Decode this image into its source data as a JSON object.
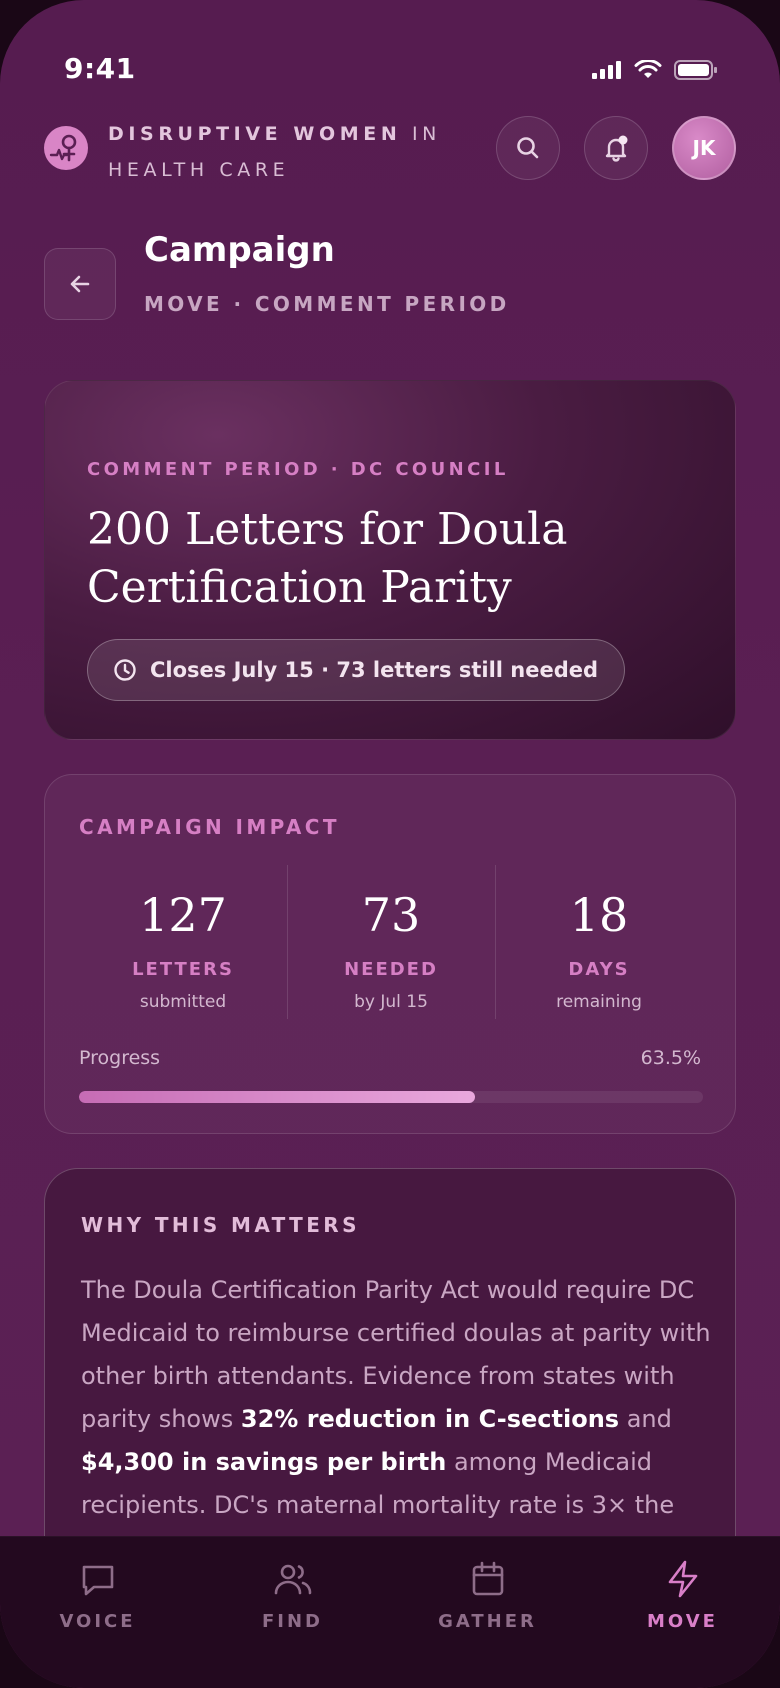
{
  "status": {
    "time": "9:41"
  },
  "header": {
    "brand_bold": "DISRUPTIVE WOMEN",
    "brand_in": " IN",
    "brand_line2": "HEALTH CARE",
    "avatar_initials": "JK"
  },
  "page": {
    "title": "Campaign",
    "subtitle": "MOVE · COMMENT PERIOD"
  },
  "hero": {
    "kicker": "COMMENT PERIOD · DC COUNCIL",
    "title": "200 Letters for Doula Certification Parity",
    "deadline": "Closes July 15 · 73 letters still needed"
  },
  "impact": {
    "label": "CAMPAIGN IMPACT",
    "stats": [
      {
        "value": "127",
        "caption": "LETTERS",
        "sub": "submitted"
      },
      {
        "value": "73",
        "caption": "NEEDED",
        "sub": "by Jul 15"
      },
      {
        "value": "18",
        "caption": "DAYS",
        "sub": "remaining"
      }
    ],
    "progress_label": "Progress",
    "progress_text": "63.5%",
    "progress_fraction": 0.635
  },
  "why": {
    "label": "WHY THIS MATTERS",
    "text1": "The Doula Certification Parity Act would require DC Medicaid to reimburse certified doulas at parity with other birth attendants. Evidence from states with parity shows ",
    "bold1": "32% reduction in C-sections",
    "text2": " and ",
    "bold2": "$4,300 in savings per birth",
    "text3": " among Medicaid recipients. DC's maternal mortality rate is 3× the"
  },
  "nav": {
    "items": [
      {
        "label": "VOICE",
        "icon": "chat-bubble-icon"
      },
      {
        "label": "FIND",
        "icon": "people-icon"
      },
      {
        "label": "GATHER",
        "icon": "calendar-icon"
      },
      {
        "label": "MOVE",
        "icon": "lightning-icon"
      }
    ],
    "active": "MOVE"
  },
  "colors": {
    "accent": "#d67fc4",
    "background": "#561c50",
    "nav_bg": "#23091f"
  }
}
